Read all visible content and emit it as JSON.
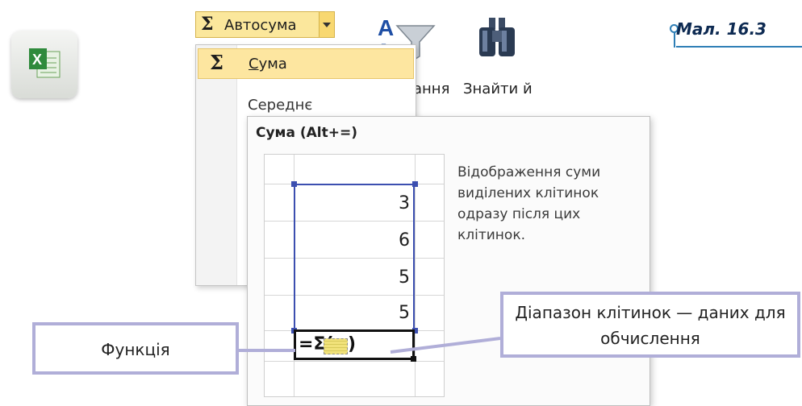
{
  "ribbon": {
    "autosum_symbol": "Σ",
    "autosum_label": "Автосума",
    "sort_fragment": "ання",
    "find_label": "Знайти й"
  },
  "menu": {
    "sum_symbol": "Σ",
    "sum_first_letter": "С",
    "sum_rest": "ума",
    "average_partial": "Середнє"
  },
  "tooltip": {
    "title": "Сума (Alt+=)",
    "description": "Відображення суми виділених клітинок одразу після цих клітинок.",
    "cells": [
      "3",
      "6",
      "5",
      "5"
    ],
    "formula_prefix": "=Σ(",
    "formula_suffix": ")"
  },
  "callouts": {
    "function": "Функція",
    "range": "Діапазон клітинок — даних для обчислення"
  },
  "caption": "Мал. 16.3",
  "colors": {
    "highlight": "#fde6a0",
    "selection": "#3c4fb0",
    "callout_border": "#b0aed8",
    "caption_text": "#0d2a52",
    "caption_line": "#2f7fb6"
  }
}
